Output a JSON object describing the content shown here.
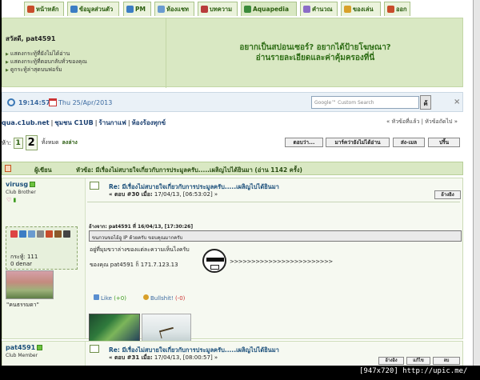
{
  "tabs": [
    {
      "label": "หน้าหลัก",
      "color": "#c84c2b"
    },
    {
      "label": "ข้อมูลส่วนตัว",
      "color": "#3c7dc4"
    },
    {
      "label": "PM",
      "color": "#3c7dc4"
    },
    {
      "label": "ห้องแชท",
      "color": "#6a9bd0"
    },
    {
      "label": "บทความ",
      "color": "#b83b3b"
    },
    {
      "label": "Aquapedia",
      "color": "#3a8a3a"
    },
    {
      "label": "คำนวณ",
      "color": "#8b6cc7"
    },
    {
      "label": "ของเล่น",
      "color": "#d8a02a"
    },
    {
      "label": "ออก",
      "color": "#c84c2b"
    }
  ],
  "header": {
    "greeting": "สวัสดี, pat4591",
    "links": [
      "แสดงกระทู้ที่ยังไม่ได้อ่าน",
      "แสดงกระทู้ที่ตอบกลับทั่วของคุณ",
      "ดูกระทู้ล่าสุดบนฟอรั่ม"
    ],
    "promo_line1": "อยากเป็นสปอนเซอร์? อยากได้ป้ายโฆษณา?",
    "promo_line2": "อ่านรายละเอียดและค่าคุ้มครองที่นี่"
  },
  "timebar": {
    "time": "19:14:57",
    "date": "Thu 25/Apr/2013",
    "search_placeholder": "Google™ Custom Search",
    "search_button": "ค้",
    "close": "×"
  },
  "breadcrumb": {
    "site": "qua.c1ub.net",
    "items": [
      "ชุมชน C1UB",
      "ร้านกาแฟ",
      "ห้องร้องทุกข์"
    ],
    "nav": "« หัวข้อที่แล้ว | หัวข้อถัดไป »"
  },
  "pager": {
    "label": "ห้า:",
    "pages": [
      "1",
      "2"
    ],
    "all": "ทั้งหมด",
    "down": "ลงล่าง",
    "buttons": [
      "ตอบว่า...",
      "มาร์คว่ายังไม่ได้อ่าน",
      "ส่ง-เมล",
      "ปริ้น"
    ]
  },
  "thread": {
    "author_col": "ผู้เขียน",
    "title": "หัวข้อ: มีเรื่องไม่สบายใจเกี่ยวกับการประมูลครับ.....เผลิญไปได้ยินมา  (อ่าน 1142 ครั้ง)"
  },
  "post1": {
    "poster": "virusg",
    "rank": "Club Brother",
    "posts": "กระทู้: 111",
    "denar": "0 denar",
    "motto": "\"คนธรรมดา\"",
    "title": "Re: มีเรื่องไม่สบายใจเกี่ยวกับการประมูลครับ.....เผลิญไปได้ยินมา",
    "meta_no": "« ตอบ #30 เมื่อ:",
    "meta_date": "17/04/13, [06:53:02] »",
    "quote_btn": "อ้างอิง",
    "quote_head": "อ้างจาก: pat4591 ที่ 16/04/13, [17:30:26]",
    "quote_text": "ขนกวนขอไอ้อู IP ด้วยครับ ขอบคุณมากครับ",
    "body1": "อยู่ที่มุมขวาล่างของแต่ละความเห็นไงครับ",
    "arrows": ">>>>>>>>>>>>>>>>>>>>>>>>",
    "body2": "ของคุณ pat4591 ก็  171.7.123.13",
    "like_label": "Like",
    "like_count": "(+0)",
    "bull_label": "Bullshit!",
    "bull_count": "(-0)"
  },
  "post2": {
    "poster": "pat4591",
    "rank": "Club Member",
    "title": "Re: มีเรื่องไม่สบายใจเกี่ยวกับการประมูลครับ.....เผลิญไปได้ยินมา",
    "meta_no": "« ตอบ #31 เมื่อ:",
    "meta_date": "17/04/13, [08:00:57] »",
    "buttons": [
      "อ้างอิง",
      "แก้ไข",
      "ลบ"
    ]
  },
  "watermark": "[947x720] http://upic.me/"
}
